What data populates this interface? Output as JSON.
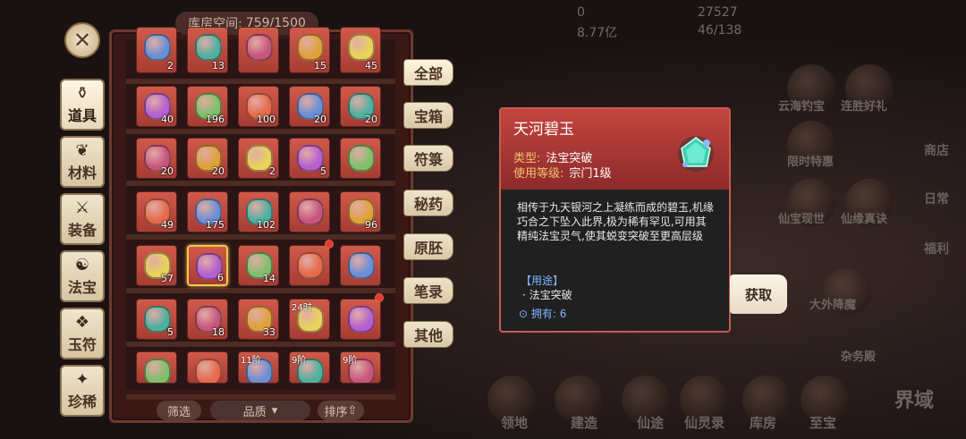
{
  "warehouse": {
    "capacity_label": "库房空间:",
    "capacity_value": "759/1500"
  },
  "left_tabs": [
    {
      "label": "道具",
      "icon": "prop-icon",
      "active": true
    },
    {
      "label": "材料",
      "icon": "material-icon"
    },
    {
      "label": "装备",
      "icon": "equipment-icon"
    },
    {
      "label": "法宝",
      "icon": "treasure-icon"
    },
    {
      "label": "玉符",
      "icon": "talisman-icon"
    },
    {
      "label": "珍稀",
      "icon": "rare-icon"
    }
  ],
  "type_tabs": [
    {
      "label": "全部",
      "active": true
    },
    {
      "label": "宝箱"
    },
    {
      "label": "符箓"
    },
    {
      "label": "秘药"
    },
    {
      "label": "原胚"
    },
    {
      "label": "笔录"
    },
    {
      "label": "其他"
    }
  ],
  "grid": [
    [
      "2",
      "13",
      "",
      "15",
      "45"
    ],
    [
      "40",
      "196",
      "100",
      "20",
      "20"
    ],
    [
      "20",
      "20",
      "2",
      "5",
      ""
    ],
    [
      "49",
      "175",
      "102",
      "",
      "96"
    ],
    [
      "57",
      "6",
      "14",
      "",
      ""
    ],
    [
      "5",
      "18",
      "33",
      "",
      ""
    ],
    [
      "",
      "",
      "",
      "",
      ""
    ]
  ],
  "grid_tags": {
    "r5c3": "24时",
    "r6c2": "11阶",
    "r6c3": "9阶",
    "r6c4": "9阶"
  },
  "filter": {
    "filter_label": "筛选",
    "quality_label": "品质",
    "sort_label": "排序"
  },
  "tooltip": {
    "title": "天河碧玉",
    "type_label": "类型:",
    "type_value": "法宝突破",
    "level_label": "使用等级:",
    "level_value": "宗门1级",
    "description": "相传于九天银河之上凝练而成的碧玉,机缘巧合之下坠入此界,极为稀有罕见,可用其精纯法宝灵气,使其蜕变突破至更高层级",
    "use_header": "【用途】",
    "use_value": "· 法宝突破",
    "owned_label": "拥有:",
    "owned_value": "6"
  },
  "get_button": "获取",
  "background": {
    "stats": [
      "0",
      "27527",
      "8.77亿",
      "46/138"
    ],
    "labels": [
      "云海钓宝",
      "连胜好礼",
      "商店",
      "限时特惠",
      "日常",
      "仙宝现世",
      "仙缘真诀",
      "福利",
      "大外降魔",
      "杂务殿",
      "领地",
      "建造",
      "仙途",
      "仙灵录",
      "库房",
      "至宝",
      "界域"
    ]
  },
  "colors": {
    "slot_red": "#c24a3e",
    "panel_dark": "#3a1816",
    "tooltip_header": "#b03a36",
    "accent_gold": "#f0c46a",
    "accent_blue": "#7fb4ff"
  }
}
